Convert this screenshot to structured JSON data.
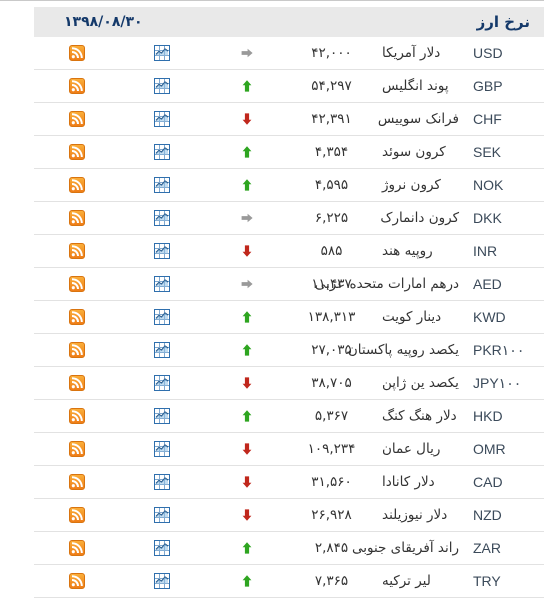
{
  "colors": {
    "header_bg": "#e9e9e9",
    "header_text": "#14396a",
    "row_border": "#e2e2e2",
    "code_text": "#3b4a5a",
    "body_text": "#333333",
    "up": "#2ea520",
    "down": "#c0271c",
    "flat": "#9a9a9a",
    "rss_orange": "#f08a24",
    "chart_blue": "#2f6fad",
    "top_rule": "#c9c9c9"
  },
  "header": {
    "title": "نرخ ارز",
    "date": "۱۳۹۸/۰۸/۳۰"
  },
  "icons": {
    "rss": "rss-feed-icon",
    "chart": "chart-grid-icon",
    "up": "arrow-up-icon",
    "down": "arrow-down-icon",
    "flat": "arrow-right-icon"
  },
  "rows": [
    {
      "code": "USD",
      "name": "دلار آمریکا",
      "price": "۴۲,۰۰۰",
      "trend": "flat"
    },
    {
      "code": "GBP",
      "name": "پوند انگلیس",
      "price": "۵۴,۲۹۷",
      "trend": "up"
    },
    {
      "code": "CHF",
      "name": "فرانک سوییس",
      "price": "۴۲,۳۹۱",
      "trend": "down"
    },
    {
      "code": "SEK",
      "name": "کرون سوئد",
      "price": "۴,۳۵۴",
      "trend": "up"
    },
    {
      "code": "NOK",
      "name": "کرون نروژ",
      "price": "۴,۵۹۵",
      "trend": "up"
    },
    {
      "code": "DKK",
      "name": "کرون دانمارک",
      "price": "۶,۲۲۵",
      "trend": "flat"
    },
    {
      "code": "INR",
      "name": "روپیه هند",
      "price": "۵۸۵",
      "trend": "down"
    },
    {
      "code": "AED",
      "name": "درهم امارات متحده عربی",
      "price": "۱۱,۴۳۷",
      "trend": "flat"
    },
    {
      "code": "KWD",
      "name": "دینار کویت",
      "price": "۱۳۸,۳۱۳",
      "trend": "up"
    },
    {
      "code": "PKR۱۰۰",
      "name": "یکصد روپیه پاکستان",
      "price": "۲۷,۰۳۵",
      "trend": "up"
    },
    {
      "code": "JPY۱۰۰",
      "name": "یکصد ین ژاپن",
      "price": "۳۸,۷۰۵",
      "trend": "down"
    },
    {
      "code": "HKD",
      "name": "دلار هنگ کنگ",
      "price": "۵,۳۶۷",
      "trend": "up"
    },
    {
      "code": "OMR",
      "name": "ریال عمان",
      "price": "۱۰۹,۲۳۴",
      "trend": "down"
    },
    {
      "code": "CAD",
      "name": "دلار کانادا",
      "price": "۳۱,۵۶۰",
      "trend": "down"
    },
    {
      "code": "NZD",
      "name": "دلار نیوزیلند",
      "price": "۲۶,۹۲۸",
      "trend": "down"
    },
    {
      "code": "ZAR",
      "name": "راند آفریقای جنوبی",
      "price": "۲,۸۴۵",
      "trend": "up"
    },
    {
      "code": "TRY",
      "name": "لیر ترکیه",
      "price": "۷,۳۶۵",
      "trend": "up"
    }
  ]
}
